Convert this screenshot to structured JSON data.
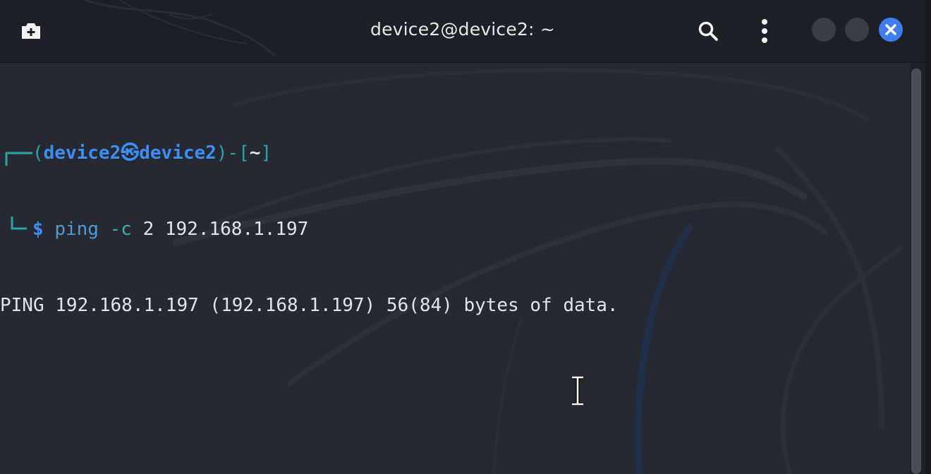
{
  "window": {
    "title": "device2@device2: ~"
  },
  "titlebar": {
    "new_tab_icon": "new-tab-icon",
    "search_icon": "search-icon",
    "menu_icon": "kebab-menu-icon",
    "minimize_icon": "minimize-circle",
    "maximize_icon": "maximize-circle",
    "close_icon": "close-x-icon"
  },
  "terminal": {
    "prompt": {
      "open_paren": "(",
      "user": "device2",
      "at_symbol": "㉿",
      "host": "device2",
      "close_paren": ")-[",
      "cwd": "~",
      "close_bracket": "]",
      "dollar": "$"
    },
    "command": {
      "name": "ping",
      "flag": "-c",
      "args": "2 192.168.1.197"
    },
    "output": [
      "PING 192.168.1.197 (192.168.1.197) 56(84) bytes of data."
    ]
  },
  "colors": {
    "prompt_line": "#2aa2a8",
    "user_host": "#3d8ef2",
    "command": "#4f9bd8",
    "close_button": "#3d7df0",
    "background": "#262932"
  }
}
